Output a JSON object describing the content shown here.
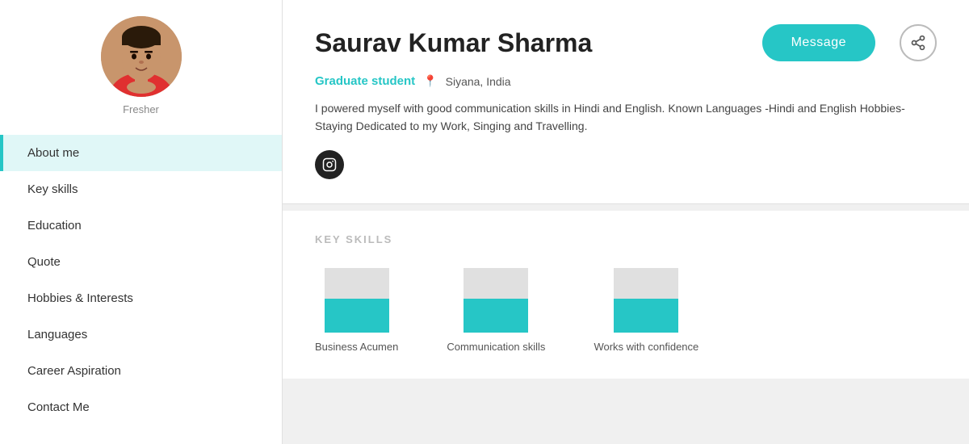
{
  "sidebar": {
    "fresher_label": "Fresher",
    "nav_items": [
      {
        "id": "about-me",
        "label": "About me",
        "active": true
      },
      {
        "id": "key-skills",
        "label": "Key skills",
        "active": false
      },
      {
        "id": "education",
        "label": "Education",
        "active": false
      },
      {
        "id": "quote",
        "label": "Quote",
        "active": false
      },
      {
        "id": "hobbies",
        "label": "Hobbies & Interests",
        "active": false
      },
      {
        "id": "languages",
        "label": "Languages",
        "active": false
      },
      {
        "id": "career-aspiration",
        "label": "Career Aspiration",
        "active": false
      },
      {
        "id": "contact-me",
        "label": "Contact Me",
        "active": false
      }
    ]
  },
  "profile": {
    "name": "Saurav Kumar Sharma",
    "title": "Graduate student",
    "location": "Siyana, India",
    "about": "I powered myself with good communication skills in Hindi and English. Known Languages -Hindi and English Hobbies- Staying Dedicated to my Work, Singing and Travelling.",
    "message_button": "Message"
  },
  "skills": {
    "section_title": "KEY SKILLS",
    "items": [
      {
        "label": "Business Acumen",
        "bg_height": 60,
        "fill_height": 42
      },
      {
        "label": "Communication skills",
        "bg_height": 60,
        "fill_height": 42
      },
      {
        "label": "Works with confidence",
        "bg_height": 60,
        "fill_height": 42
      }
    ]
  }
}
